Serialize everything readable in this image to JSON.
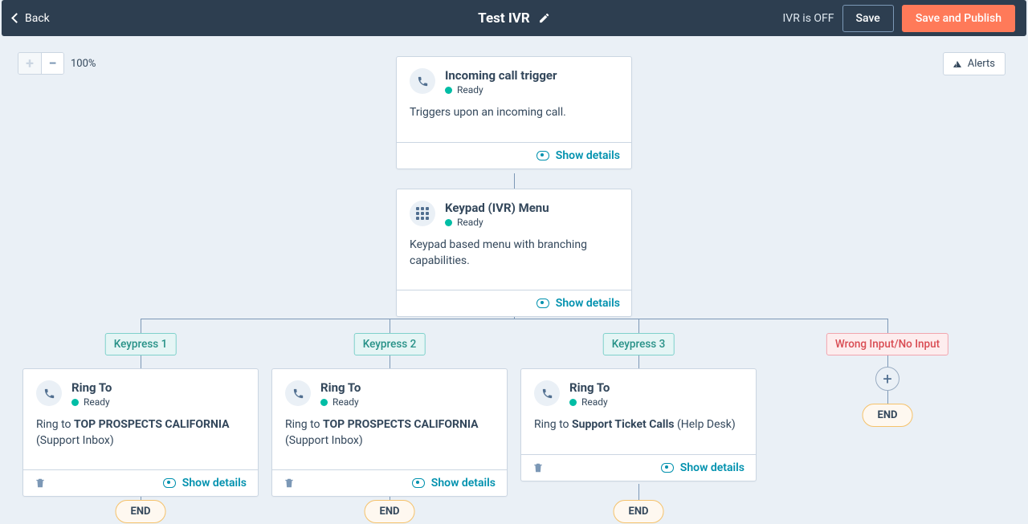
{
  "header": {
    "back": "Back",
    "title": "Test IVR",
    "status": "IVR is OFF",
    "save": "Save",
    "publish": "Save and Publish"
  },
  "toolbar": {
    "zoom": "100%",
    "alerts": "Alerts"
  },
  "actions": {
    "show": "Show details",
    "end": "END"
  },
  "nodes": {
    "trigger": {
      "title": "Incoming call trigger",
      "status": "Ready",
      "desc": "Triggers upon an incoming call."
    },
    "menu": {
      "title": "Keypad (IVR) Menu",
      "status": "Ready",
      "desc": "Keypad based menu with branching capabilities."
    },
    "branches": {
      "k1": {
        "label": "Keypress 1",
        "title": "Ring To",
        "status": "Ready",
        "pre": "Ring to ",
        "bold": "TOP PROSPECTS CALIFORNIA",
        "suffix": " (Support Inbox)"
      },
      "k2": {
        "label": "Keypress 2",
        "title": "Ring To",
        "status": "Ready",
        "pre": "Ring to ",
        "bold": "TOP PROSPECTS CALIFORNIA",
        "suffix": " (Support Inbox)"
      },
      "k3": {
        "label": "Keypress 3",
        "title": "Ring To",
        "status": "Ready",
        "pre": "Ring to ",
        "bold": "Support Ticket Calls",
        "suffix": " (Help Desk)"
      },
      "wrong": {
        "label": "Wrong Input/No Input"
      }
    }
  }
}
